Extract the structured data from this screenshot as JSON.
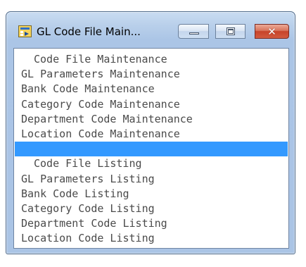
{
  "window": {
    "title": "GL Code File Main...",
    "icon": "app-icon",
    "controls": {
      "minimize": "minimize-icon",
      "maximize": "maximize-icon",
      "close": "✕"
    }
  },
  "menu": {
    "items": [
      {
        "label": "Code File Maintenance",
        "type": "header"
      },
      {
        "label": "GL Parameters Maintenance",
        "type": "item"
      },
      {
        "label": "Bank Code Maintenance",
        "type": "item"
      },
      {
        "label": "Category Code Maintenance",
        "type": "item"
      },
      {
        "label": "Department Code Maintenance",
        "type": "item"
      },
      {
        "label": "Location Code Maintenance",
        "type": "item"
      },
      {
        "label": "",
        "type": "selected"
      },
      {
        "label": "Code File Listing",
        "type": "header"
      },
      {
        "label": "GL Parameters Listing",
        "type": "item"
      },
      {
        "label": "Bank Code Listing",
        "type": "item"
      },
      {
        "label": "Category Code Listing",
        "type": "item"
      },
      {
        "label": "Department Code Listing",
        "type": "item"
      },
      {
        "label": "Location Code Listing",
        "type": "item"
      }
    ]
  },
  "colors": {
    "selection": "#3399ff",
    "text": "#4a4a4a",
    "frame": "#aac4e5"
  }
}
